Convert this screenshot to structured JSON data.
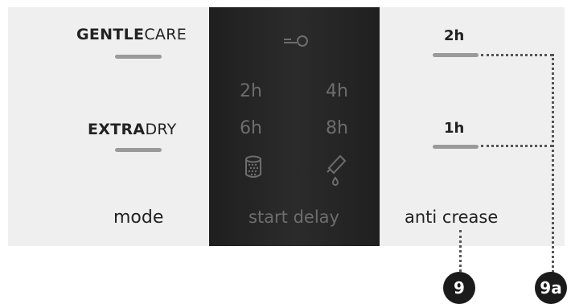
{
  "left": {
    "gentlecare_bold": "GENTLE",
    "gentlecare_light": "CARE",
    "extradry_bold": "EXTRA",
    "extradry_light": "DRY",
    "mode_label": "mode"
  },
  "center": {
    "key_icon": "key-lock-icon",
    "h2": "2h",
    "h4": "4h",
    "h6": "6h",
    "h8": "8h",
    "drum_icon": "drum-icon",
    "drop_icon": "dropper-icon",
    "start_delay_label": "start delay"
  },
  "right": {
    "h2_label": "2h",
    "h1_label": "1h",
    "anti_crease_label": "anti crease"
  },
  "callouts": {
    "badge_9": "9",
    "badge_9a": "9a"
  },
  "colors": {
    "panel": "#efefef",
    "center_panel": "#262626",
    "center_text": "#6d6d6d",
    "bar": "#9a9a9a",
    "badge": "#1b1b1b"
  }
}
